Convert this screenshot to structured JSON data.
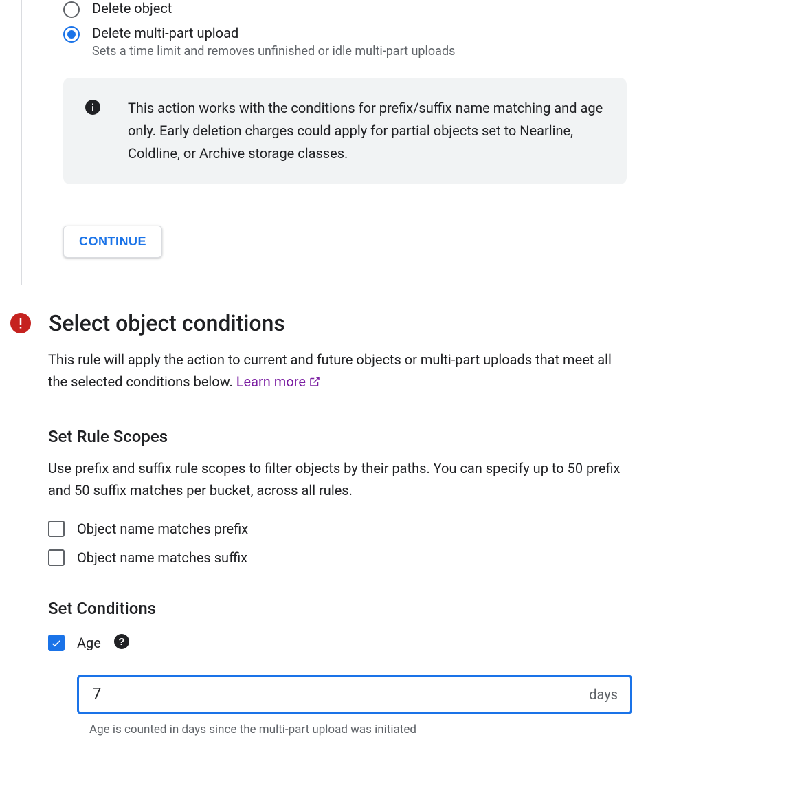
{
  "action": {
    "options": {
      "delete_object": {
        "label": "Delete object",
        "selected": false
      },
      "delete_multipart": {
        "label": "Delete multi-part upload",
        "sublabel": "Sets a time limit and removes unfinished or idle multi-part uploads",
        "selected": true
      }
    },
    "info_text": "This action works with the conditions for prefix/suffix name matching and age only. Early deletion charges could apply for partial objects set to Nearline, Coldline, or Archive storage classes.",
    "continue_label": "CONTINUE"
  },
  "conditions": {
    "title": "Select object conditions",
    "description": "This rule will apply the action to current and future objects or multi-part uploads that meet all the selected conditions below. ",
    "learn_more_label": "Learn more",
    "rule_scopes": {
      "heading": "Set Rule Scopes",
      "description": "Use prefix and suffix rule scopes to filter objects by their paths. You can specify up to 50 prefix and 50 suffix matches per bucket, across all rules.",
      "prefix": {
        "label": "Object name matches prefix",
        "checked": false
      },
      "suffix": {
        "label": "Object name matches suffix",
        "checked": false
      }
    },
    "set_conditions": {
      "heading": "Set Conditions",
      "age": {
        "label": "Age",
        "checked": true,
        "value": "7",
        "suffix": "days",
        "helper": "Age is counted in days since the multi-part upload was initiated"
      }
    }
  }
}
